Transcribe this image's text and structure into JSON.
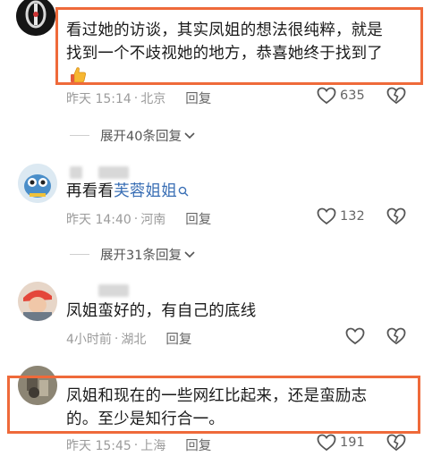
{
  "comments": [
    {
      "text_line1": "看过她的访谈，其实凤姐的想法很纯粹，就是",
      "text_line2": "找到一个不歧视她的地方，恭喜她终于找到了",
      "emoji": "thumbs-up",
      "time": "昨天 15:14",
      "location": "北京",
      "reply": "回复",
      "likes": "635"
    },
    {
      "text_prefix": "再看看",
      "mention": "芙蓉姐姐",
      "time": "昨天 14:40",
      "location": "河南",
      "reply": "回复",
      "likes": "132"
    },
    {
      "text": "凤姐蛮好的，有自己的底线",
      "time": "4小时前",
      "location": "湖北",
      "reply": "回复",
      "likes": ""
    },
    {
      "text_line1": "凤姐和现在的一些网红比起来，还是蛮励志",
      "text_line2": "的。至少是知行合一。",
      "time": "昨天 15:45",
      "location": "上海",
      "reply": "回复",
      "likes": "191"
    }
  ],
  "expand_1": "展开40条回复",
  "expand_2": "展开31条回复",
  "colors": {
    "highlight": "#ef6a3a",
    "mention": "#3a6fb5",
    "meta": "#9b9b9b"
  },
  "icons": [
    "heart-icon",
    "broken-heart-icon",
    "chevron-down-icon",
    "search-icon",
    "thumbs-up-emoji"
  ]
}
